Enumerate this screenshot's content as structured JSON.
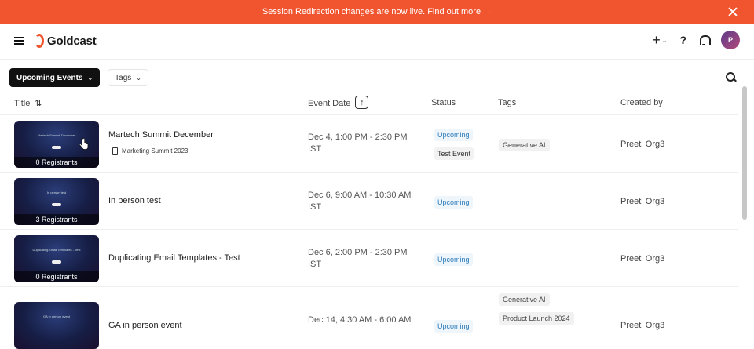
{
  "banner": {
    "text": "Session Redirection changes are now live. Find out more →"
  },
  "header": {
    "app_name": "Goldcast",
    "plus": "+",
    "help": "?",
    "avatar_initial": "P"
  },
  "filters": {
    "event_filter": "Upcoming Events",
    "tags_filter": "Tags"
  },
  "table": {
    "columns": [
      "Title",
      "Event Date",
      "Status",
      "Tags",
      "Created by"
    ],
    "rows": [
      {
        "thumb_text": "Martech Summit December",
        "registrants": "0 Registrants",
        "title": "Martech Summit December",
        "subtag": "Marketing Summit 2023",
        "date_line1": "Dec 4, 1:00 PM - 2:30 PM",
        "date_line2": "IST",
        "statuses": [
          "Upcoming",
          "Test Event"
        ],
        "tags": [
          "Generative AI"
        ],
        "created_by": "Preeti Org3"
      },
      {
        "thumb_text": "In person test",
        "registrants": "3 Registrants",
        "title": "In person test",
        "subtag": "",
        "date_line1": "Dec 6, 9:00 AM - 10:30 AM",
        "date_line2": "IST",
        "statuses": [
          "Upcoming"
        ],
        "tags": [],
        "created_by": "Preeti Org3"
      },
      {
        "thumb_text": "Duplicating Email Templates - Test",
        "registrants": "0 Registrants",
        "title": "Duplicating Email Templates - Test",
        "subtag": "",
        "date_line1": "Dec 6, 2:00 PM - 2:30 PM",
        "date_line2": "IST",
        "statuses": [
          "Upcoming"
        ],
        "tags": [],
        "created_by": "Preeti Org3"
      },
      {
        "thumb_text": "GA in person event",
        "registrants": "",
        "title": "GA in person event",
        "subtag": "",
        "date_line1": "Dec 14, 4:30 AM - 6:00 AM",
        "date_line2": "",
        "statuses": [
          "Upcoming"
        ],
        "tags": [
          "Generative AI",
          "Product Launch 2024"
        ],
        "created_by": "Preeti Org3"
      }
    ]
  },
  "colors": {
    "banner": "#f0552f",
    "status_upcoming": "#2b7bb9",
    "filter_active": "#111111"
  },
  "icons": [
    "menu-icon",
    "goldcast-logo-icon",
    "plus-icon",
    "help-icon",
    "bell-icon",
    "search-icon",
    "sort-icon",
    "sort-ascending-icon",
    "document-icon",
    "close-icon"
  ]
}
